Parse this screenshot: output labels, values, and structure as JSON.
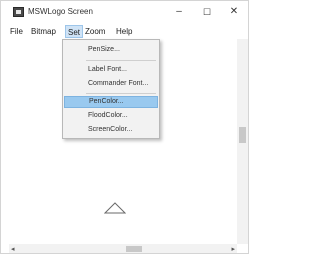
{
  "window": {
    "title": "MSWLogo Screen",
    "minimize_glyph": "–",
    "maximize_glyph": "☐",
    "close_glyph": "✕"
  },
  "menubar": {
    "items": [
      "File",
      "Bitmap",
      "Set",
      "Zoom",
      "Help"
    ],
    "active": "Set"
  },
  "set_menu": {
    "items": [
      "PenSize...",
      "Label Font...",
      "Commander Font...",
      "PenColor...",
      "FloodColor...",
      "ScreenColor..."
    ],
    "highlighted": "PenColor..."
  },
  "scrollbars": {
    "left_arrow": "◂",
    "right_arrow": "▸"
  },
  "colors": {
    "menu_highlight": "#99c9ef",
    "active_menu_bg": "#cfe3f6"
  },
  "canvas": {
    "turtle_icon": "triangle-turtle-icon"
  }
}
